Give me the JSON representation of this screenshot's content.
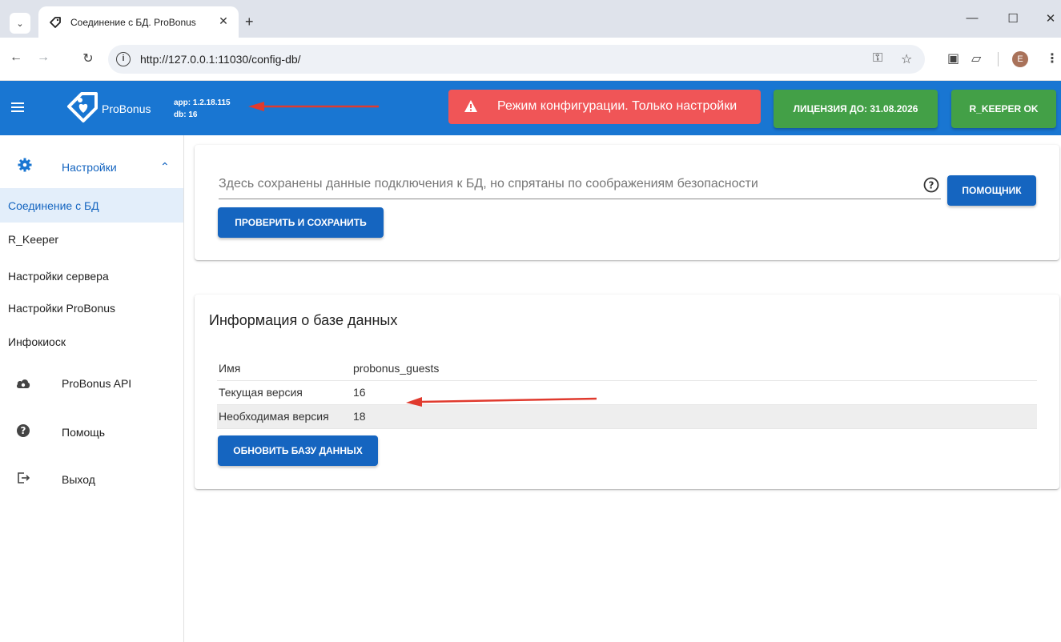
{
  "browser": {
    "tab_title": "Соединение с БД. ProBonus",
    "url": "http://127.0.0.1:11030/config-db/",
    "profile_initial": "E"
  },
  "appbar": {
    "brand": "ProBonus",
    "version_app": "app: 1.2.18.115",
    "version_db": "db: 16",
    "mode_alert": "Режим конфигурации. Только настройки",
    "license_btn": "ЛИЦЕНЗИЯ ДО: 31.08.2026",
    "keeper_btn": "R_KEEPER OK"
  },
  "sidebar": {
    "settings_group": "Настройки",
    "sub_items": [
      "Соединение с БД",
      "R_Keeper",
      "Настройки сервера",
      "Настройки ProBonus",
      "Инфокиоск"
    ],
    "api": "ProBonus API",
    "help": "Помощь",
    "logout": "Выход"
  },
  "connection_card": {
    "field_text": "Здесь сохранены данные подключения к БД, но спрятаны по соображениям безопасности",
    "assistant_btn": "ПОМОЩНИК",
    "check_save_btn": "ПРОВЕРИТЬ И СОХРАНИТЬ"
  },
  "db_info_card": {
    "title": "Информация о базе данных",
    "rows": [
      {
        "label": "Имя",
        "value": "probonus_guests"
      },
      {
        "label": "Текущая версия",
        "value": "16"
      },
      {
        "label": "Необходимая версия",
        "value": "18"
      }
    ],
    "update_btn": "ОБНОВИТЬ БАЗУ ДАННЫХ"
  },
  "colors": {
    "appbar": "#1976d2",
    "alert": "#f05557",
    "success": "#43a047",
    "primary_button": "#1565c0",
    "annotation_arrow": "#e03a2e"
  },
  "icons": [
    "chevron-down-icon",
    "tag-favicon-icon",
    "close-icon",
    "plus-icon",
    "back-icon",
    "forward-icon",
    "reload-icon",
    "info-icon",
    "key-icon",
    "star-icon",
    "menu-icon",
    "gear-icon",
    "chevron-up-icon",
    "cloud-api-icon",
    "help-icon",
    "logout-icon",
    "warning-icon",
    "question-circle-icon"
  ]
}
